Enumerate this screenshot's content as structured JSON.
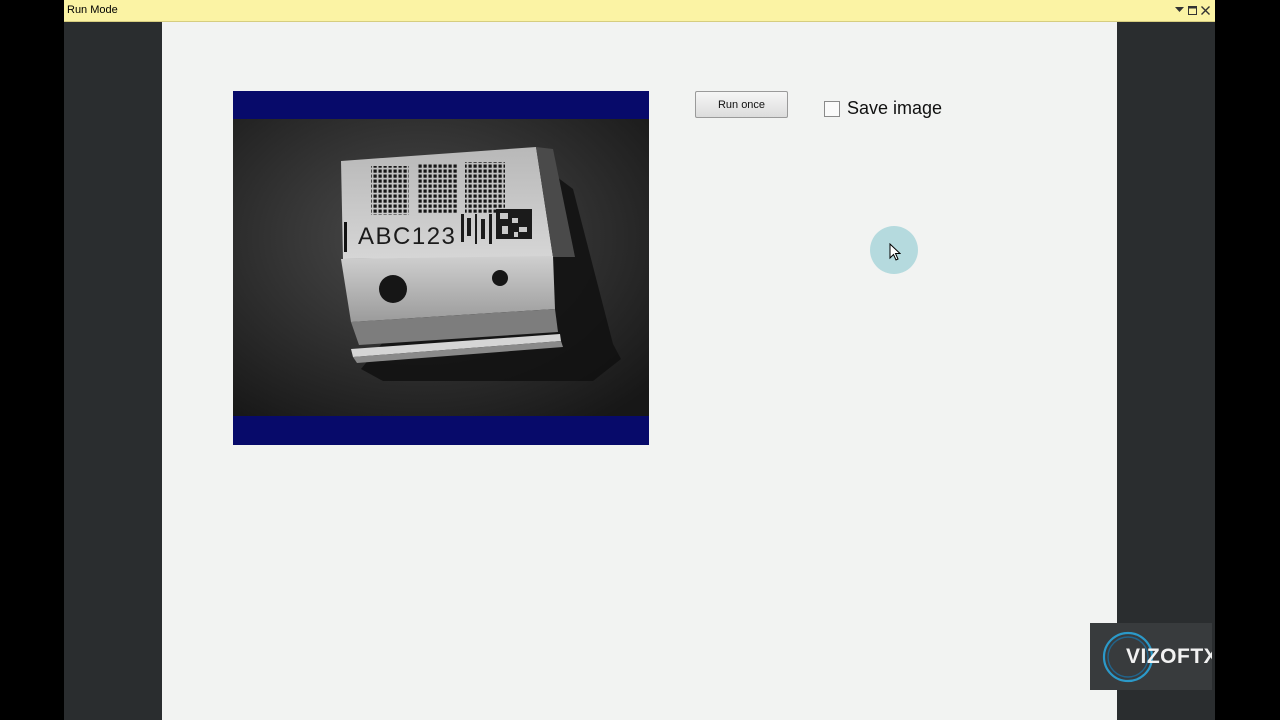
{
  "window": {
    "title": "Run Mode",
    "controls": {
      "dropdown_icon": "dropdown-arrow-icon",
      "maximize_icon": "maximize-icon",
      "close_icon": "close-icon"
    }
  },
  "toolbar": {
    "run_once_label": "Run once",
    "save_image": {
      "label": "Save image",
      "checked": false
    }
  },
  "camera": {
    "image_text": "ABC123",
    "letterbox_color": "#070a6a"
  },
  "watermark": {
    "logo_text": "VIZOFTX"
  },
  "colors": {
    "titlebar": "#fbf3a4",
    "panel": "#f2f3f2",
    "side_bars": "#2a2d2f",
    "cursor_highlight": "#a0d2d7"
  }
}
